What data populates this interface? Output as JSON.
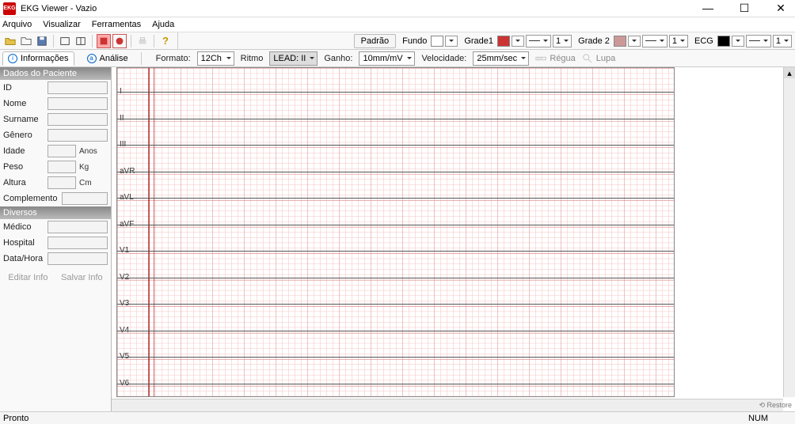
{
  "window": {
    "title": "EKG Viewer - Vazio"
  },
  "menu": {
    "arquivo": "Arquivo",
    "visualizar": "Visualizar",
    "ferramentas": "Ferramentas",
    "ajuda": "Ajuda"
  },
  "toolbar": {
    "padrao": "Padrão",
    "fundo": "Fundo",
    "fundo_color": "#ffffff",
    "grade1": "Grade1",
    "grade1_color": "#cc3333",
    "grade1_num": "1",
    "grade2": "Grade 2",
    "grade2_color": "#cc9999",
    "grade2_num": "1",
    "ecg": "ECG",
    "ecg_color": "#000000",
    "ecg_num": "1"
  },
  "tabs": {
    "info": "Informações",
    "analise": "Análise"
  },
  "params": {
    "formato_label": "Formato:",
    "formato": "12Ch",
    "ritmo_label": "Ritmo",
    "ritmo": "LEAD: II",
    "ganho_label": "Ganho:",
    "ganho": "10mm/mV",
    "velocidade_label": "Velocidade:",
    "velocidade": "25mm/sec",
    "regua": "Régua",
    "lupa": "Lupa"
  },
  "sidebar": {
    "sec1": "Dados do Paciente",
    "fields": {
      "id": "ID",
      "nome": "Nome",
      "surname": "Surname",
      "genero": "Gênero",
      "idade": "Idade",
      "idade_u": "Anos",
      "peso": "Peso",
      "peso_u": "Kg",
      "altura": "Altura",
      "altura_u": "Cm",
      "complemento": "Complemento"
    },
    "sec2": "Diversos",
    "fields2": {
      "medico": "Médico",
      "hospital": "Hospital",
      "datahora": "Data/Hora"
    },
    "editar": "Editar Info",
    "salvar": "Salvar Info"
  },
  "leads": [
    "I",
    "II",
    "III",
    "aVR",
    "aVL",
    "aVF",
    "V1",
    "V2",
    "V3",
    "V4",
    "V5",
    "V6"
  ],
  "status": {
    "ready": "Pronto",
    "num": "NUM"
  }
}
